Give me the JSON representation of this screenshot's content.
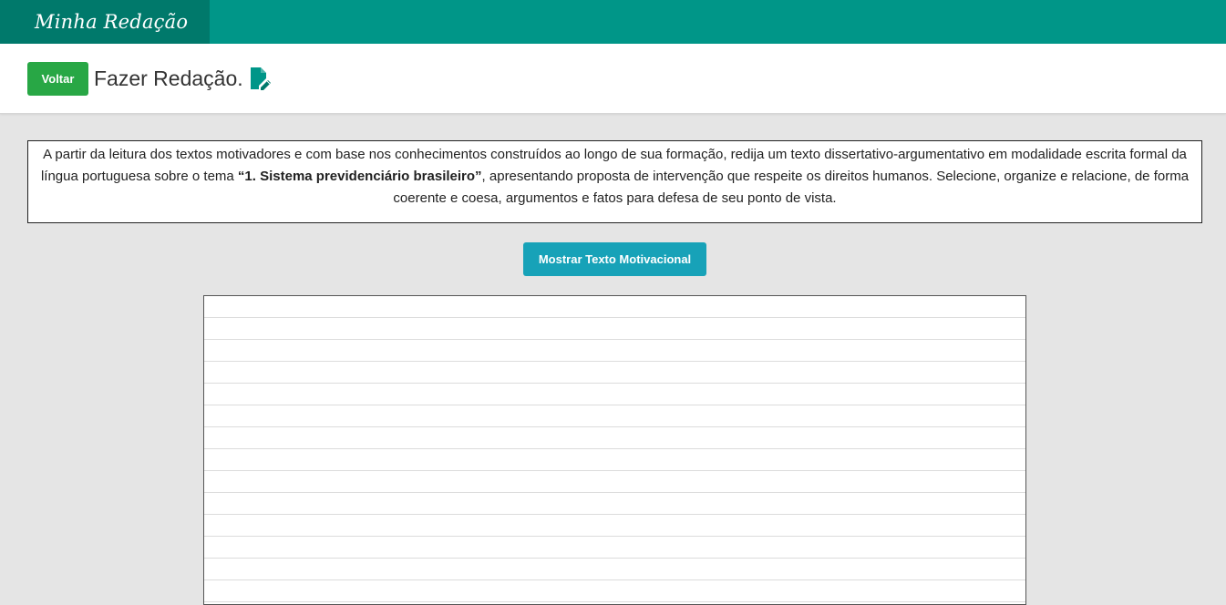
{
  "navbar": {
    "brand": "Minha Redação",
    "background": "#009688",
    "brand_background": "#00796b"
  },
  "header": {
    "back_button": "Voltar",
    "title": "Fazer Redação.",
    "title_icon": "document-edit-icon"
  },
  "prompt": {
    "text_before": "A partir da leitura dos textos motivadores e com base nos conhecimentos construídos ao longo de sua formação, redija um texto dissertativo-argumentativo em modalidade escrita formal da língua portuguesa sobre o tema ",
    "theme": "“1. Sistema previdenciário brasileiro”",
    "text_after": ", apresentando proposta de intervenção que respeite os direitos humanos. Selecione, organize e relacione, de forma coerente e coesa, argumentos e fatos para defesa de seu ponto de vista."
  },
  "motivational_button": {
    "label": "Mostrar Texto Motivacional",
    "color": "#17a2b8"
  },
  "essay": {
    "value": ""
  },
  "colors": {
    "back_button": "#28a745",
    "page_background": "#e5e5e5",
    "icon": "#009688"
  }
}
